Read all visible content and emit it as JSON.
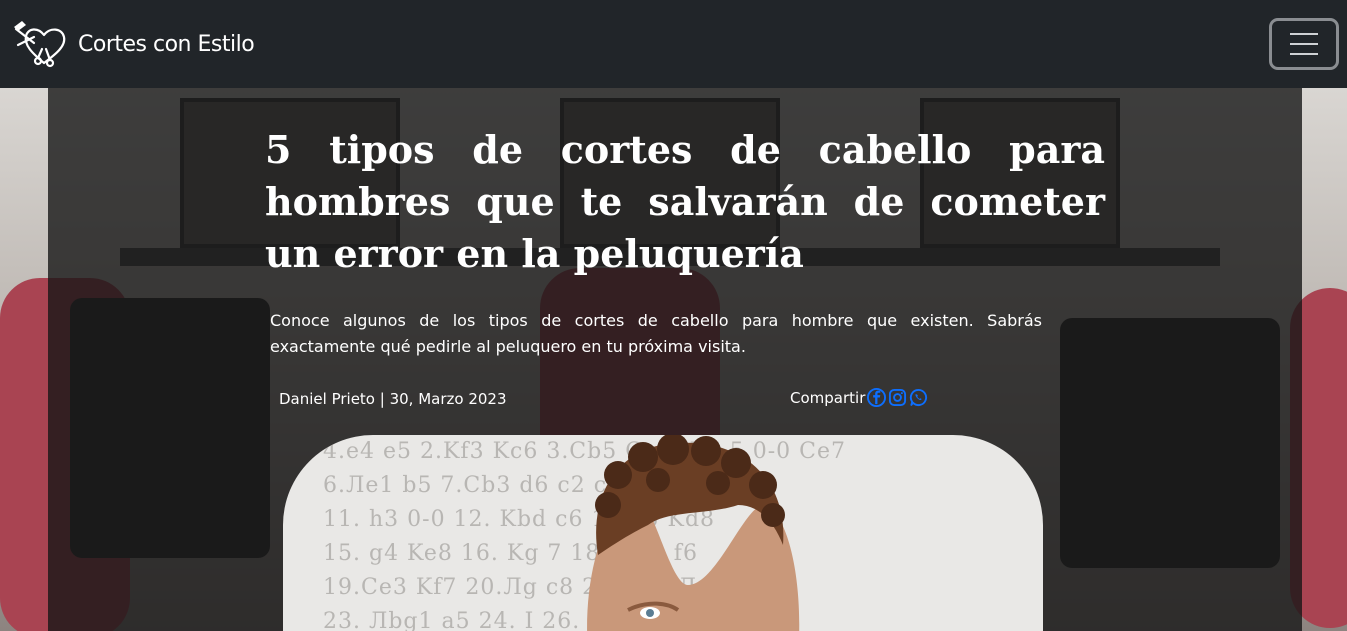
{
  "navbar": {
    "brand_text": "Cortes con Estilo",
    "brand_icon": "scissors-heart-logo",
    "toggler_icon": "hamburger-menu-icon"
  },
  "article": {
    "title": "5 tipos de cortes de cabello para hombres que te salvarán de cometer un error en la peluquería",
    "lead": "Conoce algunos de los tipos de cortes de cabello para hombre que existen. Sabrás exactamente qué pedirle al peluquero en tu próxima visita.",
    "author_date": "Daniel Prieto | 30, Marzo 2023",
    "share_label": "Compartir",
    "share_icons": [
      "facebook-icon",
      "instagram-icon",
      "whatsapp-icon"
    ]
  },
  "hero": {
    "chess_lines": [
      "4.e4 e5  2.Kf3 Kc6  3.Cb5  Ca4 Kf6 5.0-0 Ce7",
      "6.Ле1 b5  7.Cb3 d6           c2 c5 10.d4 Фc7",
      "11. h3 0-0  12. Kbd             c6    14.d5 Kd8",
      "15. g4 Ke8  16. Kg               7   18. Лg1 f6",
      "19.Ce3 Kf7 20.Лg               c8 22.Лh1 Лg8",
      "23. Лbg1 a5  24. I              26. Cd3 Фa6"
    ]
  },
  "colors": {
    "navbar_bg": "#212529",
    "share_icon": "#0d6efd",
    "text": "#ffffff"
  }
}
